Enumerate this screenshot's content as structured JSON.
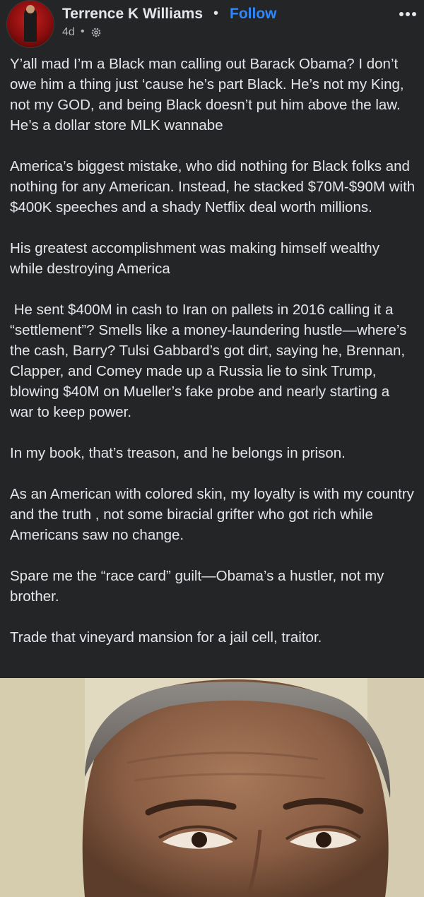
{
  "header": {
    "author_name": "Terrence K Williams",
    "separator": "•",
    "follow_label": "Follow",
    "timestamp": "4d",
    "timestamp_separator": "•",
    "audience_icon": "gear-icon",
    "more_icon": "more-horizontal-icon"
  },
  "post": {
    "paragraphs": [
      "Y’all mad I’m a Black man calling out Barack Obama? I don’t owe him a thing just ‘cause he’s part Black. He’s not my King, not my GOD, and being Black doesn’t put him above the law. He’s a dollar store MLK wannabe",
      "America’s biggest mistake, who did nothing for Black folks and nothing for any American. Instead, he stacked $70M-$90M with $400K speeches and a shady Netflix deal worth millions.",
      "His greatest accomplishment was making himself wealthy while destroying America",
      " He sent $400M in cash to Iran on pallets in 2016 calling it a “settlement”? Smells like a money-laundering hustle—where’s the cash, Barry? Tulsi Gabbard’s got dirt, saying he, Brennan, Clapper, and Comey made up a Russia lie to sink Trump, blowing $40M on Mueller’s fake probe and nearly starting a war to keep power.",
      "In my book, that’s treason, and he belongs in prison.",
      "As an American with colored skin, my loyalty is with my country and the truth , not some biracial grifter who got rich while Americans saw no change.",
      "Spare me the “race card” guilt—Obama’s a hustler, not my brother.",
      "Trade that vineyard mansion for a jail cell, traitor."
    ]
  },
  "colors": {
    "background": "#242526",
    "text_primary": "#e4e6eb",
    "text_secondary": "#b0b3b8",
    "accent_link": "#2d88ff"
  }
}
